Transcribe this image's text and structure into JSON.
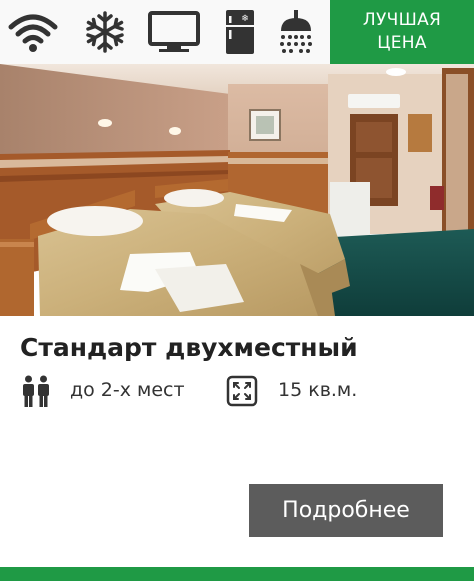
{
  "amenities": [
    {
      "icon": "wifi-icon"
    },
    {
      "icon": "air-conditioning-icon"
    },
    {
      "icon": "tv-icon"
    },
    {
      "icon": "fridge-icon"
    },
    {
      "icon": "shower-icon"
    }
  ],
  "badge": {
    "line1": "ЛУЧШАЯ",
    "line2": "ЦЕНА",
    "color": "#1f9a45"
  },
  "room": {
    "title": "Стандарт двухместный",
    "capacity": "до 2-х мест",
    "area": "15 кв.м."
  },
  "actions": {
    "details_label": "Подробнее"
  },
  "colors": {
    "accent": "#1f9a45",
    "button": "#5c5c5c"
  }
}
